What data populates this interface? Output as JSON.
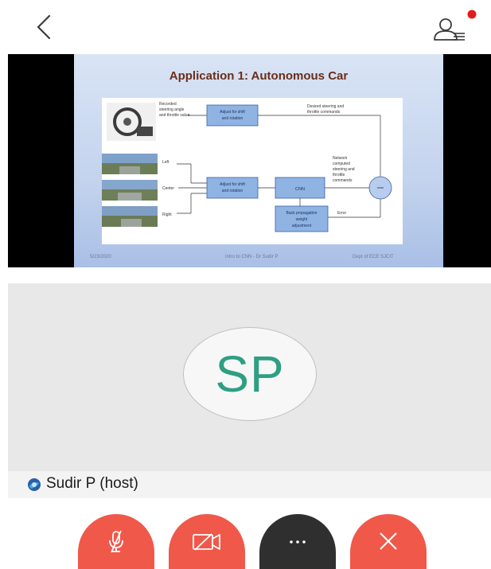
{
  "slide": {
    "title": "Application 1: Autonomous Car",
    "recorded_label_1": "Recorded",
    "recorded_label_2": "steering angle",
    "recorded_label_3": "and throttle value",
    "adjust_label_1": "Adjust for shift",
    "adjust_label_2": "and rotation",
    "desired_label_1": "Desired steering and",
    "desired_label_2": "throttle commands",
    "camera_left": "Left",
    "camera_center": "Center",
    "camera_right": "Right",
    "cnn_label": "CNN",
    "network_label_1": "Network",
    "network_label_2": "computed",
    "network_label_3": "steering and",
    "network_label_4": "throttle",
    "network_label_5": "commands",
    "backprop_label_1": "Back propagation",
    "backprop_label_2": "weight",
    "backprop_label_3": "adjustment",
    "error_label": "Error",
    "footer_date": "5/23/2020",
    "footer_center": "Intro to CNN - Dr Sudir P",
    "footer_right": "Dept of ECE SJCIT"
  },
  "participant": {
    "initials": "SP",
    "name_label": "Sudir P (host)"
  },
  "colors": {
    "accent_red": "#f0584a",
    "avatar_text": "#2e9f83",
    "notification_dot": "#e51b1b"
  },
  "icons": {
    "back": "chevron-left-icon",
    "participants": "participants-icon",
    "mute": "microphone-off-icon",
    "camera": "video-off-icon",
    "more": "more-horizontal-icon",
    "leave": "close-icon"
  }
}
